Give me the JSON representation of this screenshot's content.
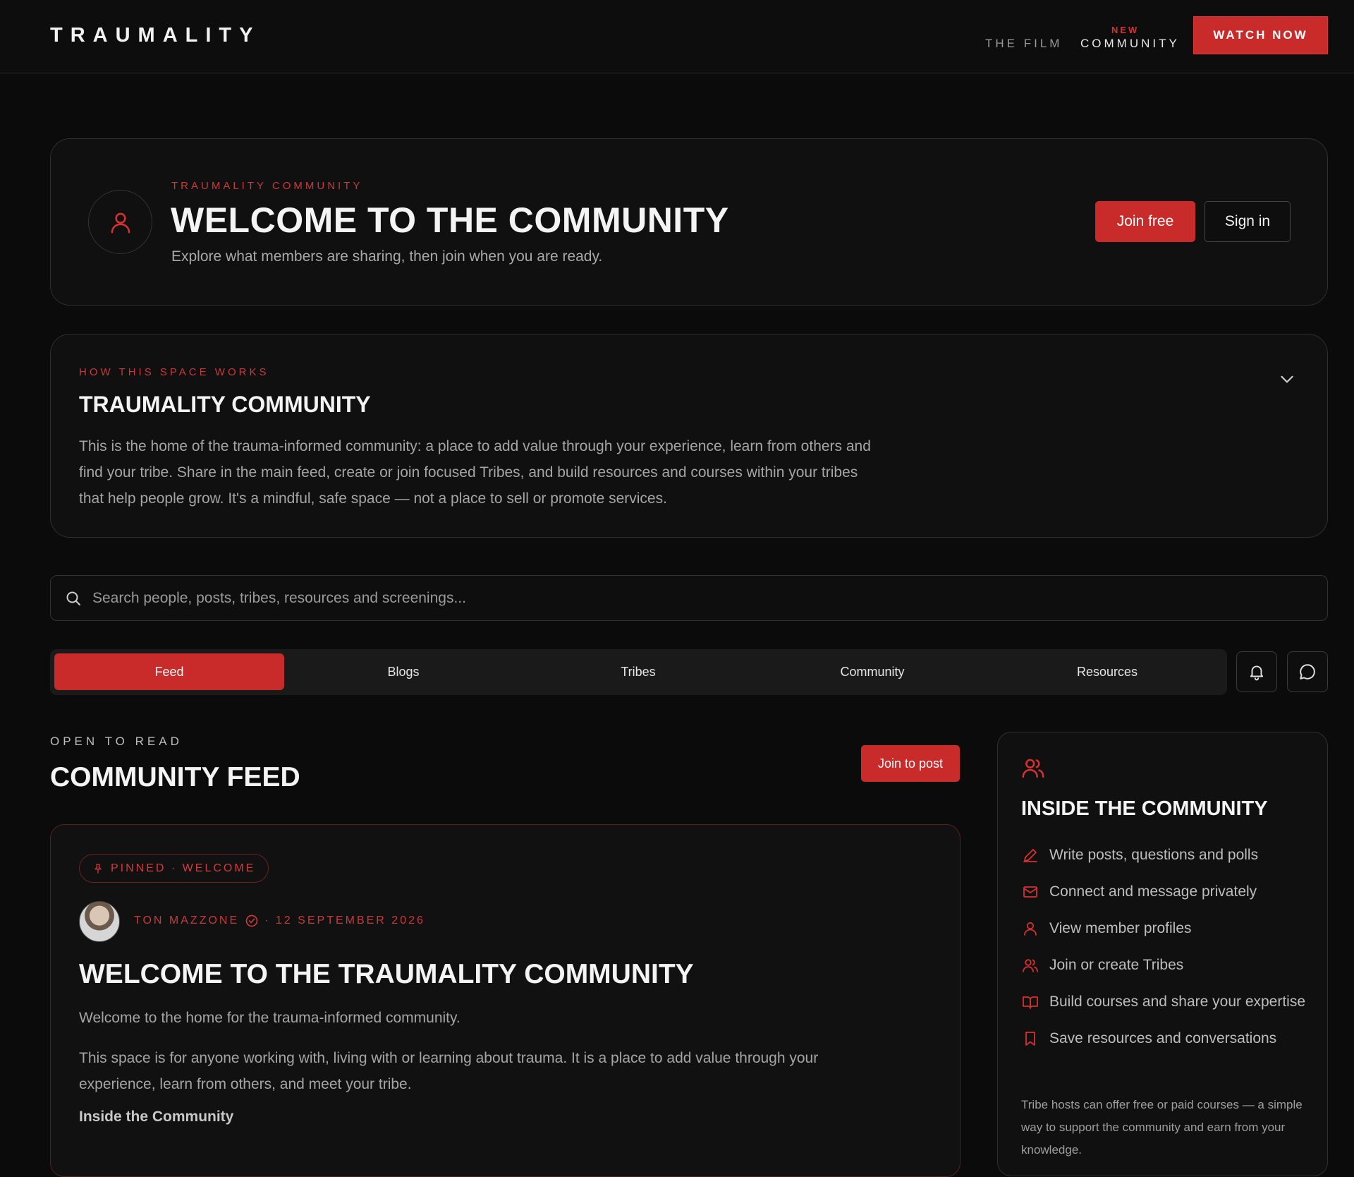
{
  "header": {
    "logo": "TRAUMALITY",
    "nav_film": "THE FILM",
    "nav_new_badge": "NEW",
    "nav_community": "COMMUNITY",
    "watch_label": "WATCH NOW"
  },
  "welcome": {
    "eyebrow": "TRAUMALITY COMMUNITY",
    "title": "WELCOME TO THE COMMUNITY",
    "subtitle": "Explore what members are sharing, then join when you are ready.",
    "join_label": "Join free",
    "signin_label": "Sign in"
  },
  "how": {
    "eyebrow": "HOW THIS SPACE WORKS",
    "title": "TRAUMALITY COMMUNITY",
    "body": "This is the home of the trauma-informed community: a place to add value through your experience, learn from others and find your tribe. Share in the main feed, create or join focused Tribes, and build resources and courses within your tribes that help people grow. It's a mindful, safe space — not a place to sell or promote services."
  },
  "search": {
    "placeholder": "Search people, posts, tribes, resources and screenings..."
  },
  "tabs": [
    {
      "label": "Feed",
      "active": true
    },
    {
      "label": "Blogs",
      "active": false
    },
    {
      "label": "Tribes",
      "active": false
    },
    {
      "label": "Community",
      "active": false
    },
    {
      "label": "Resources",
      "active": false
    }
  ],
  "feed": {
    "eyebrow": "OPEN TO READ",
    "title": "COMMUNITY FEED",
    "join_post_label": "Join to post"
  },
  "post": {
    "pill": "PINNED · WELCOME",
    "author": "TON MAZZONE",
    "date": "· 12 SEPTEMBER 2026",
    "title": "WELCOME TO THE TRAUMALITY COMMUNITY",
    "p1": "Welcome to the home for the trauma-informed community.",
    "p2": "This space is for anyone working with, living with or learning about trauma. It is a place to add value through your experience, learn from others, and meet your tribe.",
    "subheading": "Inside the Community"
  },
  "side": {
    "title": "INSIDE THE COMMUNITY",
    "items": [
      {
        "icon": "pencil-icon",
        "label": "Write posts, questions and polls"
      },
      {
        "icon": "mail-icon",
        "label": "Connect and message privately"
      },
      {
        "icon": "user-icon",
        "label": "View member profiles"
      },
      {
        "icon": "users-icon",
        "label": "Join or create Tribes"
      },
      {
        "icon": "book-icon",
        "label": "Build courses and share your expertise"
      },
      {
        "icon": "bookmark-icon",
        "label": "Save resources and conversations"
      }
    ],
    "note": "Tribe hosts can offer free or paid courses — a simple way to support the community and earn from your knowledge."
  },
  "colors": {
    "accent": "#c92a2a",
    "background": "#0b0b0c",
    "card": "#101011"
  }
}
